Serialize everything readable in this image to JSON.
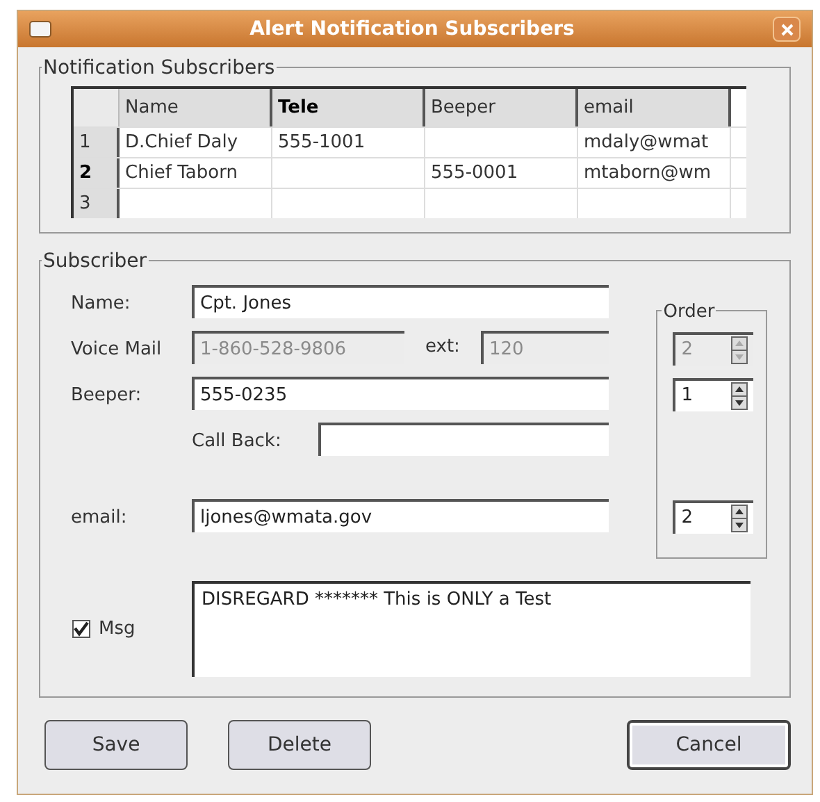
{
  "window": {
    "title": "Alert Notification Subscribers"
  },
  "subscribers_group": {
    "title": "Notification Subscribers",
    "table": {
      "columns": [
        {
          "label": "Name",
          "selected": false
        },
        {
          "label": "Tele",
          "selected": true
        },
        {
          "label": "Beeper",
          "selected": false
        },
        {
          "label": "email",
          "selected": false
        }
      ],
      "rows": [
        {
          "number": "1",
          "selected": false,
          "cells": [
            "D.Chief Daly",
            "555-1001",
            "",
            "mdaly@wmat"
          ]
        },
        {
          "number": "2",
          "selected": true,
          "cells": [
            "Chief Taborn",
            "",
            "555-0001",
            "mtaborn@wm"
          ]
        },
        {
          "number": "3",
          "selected": false,
          "cells": [
            "",
            "",
            "",
            ""
          ]
        }
      ]
    }
  },
  "subscriber_group": {
    "title": "Subscriber",
    "order_title": "Order",
    "fields": [
      {
        "kind": "text",
        "label": "Name:",
        "value": "Cpt. Jones",
        "disabled": false
      },
      {
        "kind": "split",
        "label": "Voice Mail",
        "value": "1-860-528-9806",
        "disabled": true,
        "ext_label": "ext:",
        "ext_value": "120",
        "order": {
          "value": "2",
          "disabled": true
        }
      },
      {
        "kind": "text",
        "label": "Beeper:",
        "value": "555-0235",
        "disabled": false,
        "order": {
          "value": "1",
          "disabled": false
        }
      },
      {
        "kind": "indented",
        "label": "Call Back:",
        "disabled": false
      },
      {
        "kind": "text",
        "label": "email:",
        "value": "ljones@wmata.gov",
        "disabled": false,
        "order": {
          "value": "2",
          "disabled": false
        }
      }
    ],
    "message": {
      "label": "Msg",
      "checked": true,
      "value": "DISREGARD ******* This is ONLY a Test"
    }
  },
  "buttons": [
    {
      "label": "Save",
      "default": false
    },
    {
      "label": "Delete",
      "default": false
    },
    {
      "label": "Cancel",
      "default": true
    }
  ]
}
